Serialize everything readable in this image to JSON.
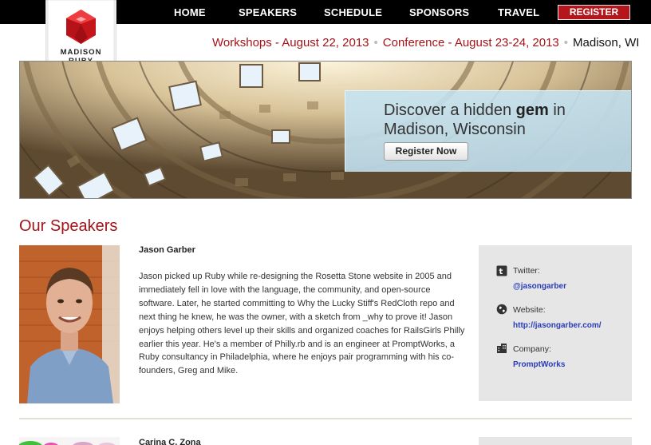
{
  "nav": {
    "items": [
      "HOME",
      "SPEAKERS",
      "SCHEDULE",
      "SPONSORS",
      "TRAVEL"
    ],
    "register": "REGISTER"
  },
  "logo": {
    "line1": "MADISON",
    "line2": "RUBY"
  },
  "dates": {
    "workshops": "Workshops - August 22, 2013",
    "conference": "Conference - August 23-24, 2013",
    "location": "Madison, WI",
    "separator": "•"
  },
  "hero": {
    "headline_pre": "Discover a hidden ",
    "headline_bold": "gem",
    "headline_post": " in",
    "headline_line2": "Madison, Wisconsin",
    "button": "Register Now"
  },
  "speakers_title": "Our Speakers",
  "speakers": [
    {
      "name": "Jason Garber",
      "bio": "Jason picked up Ruby while re-designing the Rosetta Stone website in 2005 and immediately fell in love with the language, the community, and open-source software. Later, he started committing to Why the Lucky Stiff's RedCloth repo and next thing he knew, he was the owner, with a sketch from _why to prove it! Jason enjoys helping others level up their skills and organized coaches for RailsGirls Philly earlier this year. He's a member of Philly.rb and is an engineer at PromptWorks, a Ruby consultancy in Philadelphia, where he enjoys pair programming with his co-founders, Greg and Mike.",
      "twitter_label": "Twitter:",
      "twitter": "@jasongarber",
      "website_label": "Website:",
      "website": "http://jasongarber.com/",
      "company_label": "Company:",
      "company": "PromptWorks"
    },
    {
      "name": "Carina C. Zona"
    }
  ],
  "icons": {
    "twitter": "twitter-icon",
    "website": "globe-icon",
    "company": "building-icon"
  },
  "colors": {
    "accent": "#a3141a",
    "link": "#2a3db8",
    "panel": "#c4e4f4",
    "sidebar": "#e6e6e6"
  }
}
